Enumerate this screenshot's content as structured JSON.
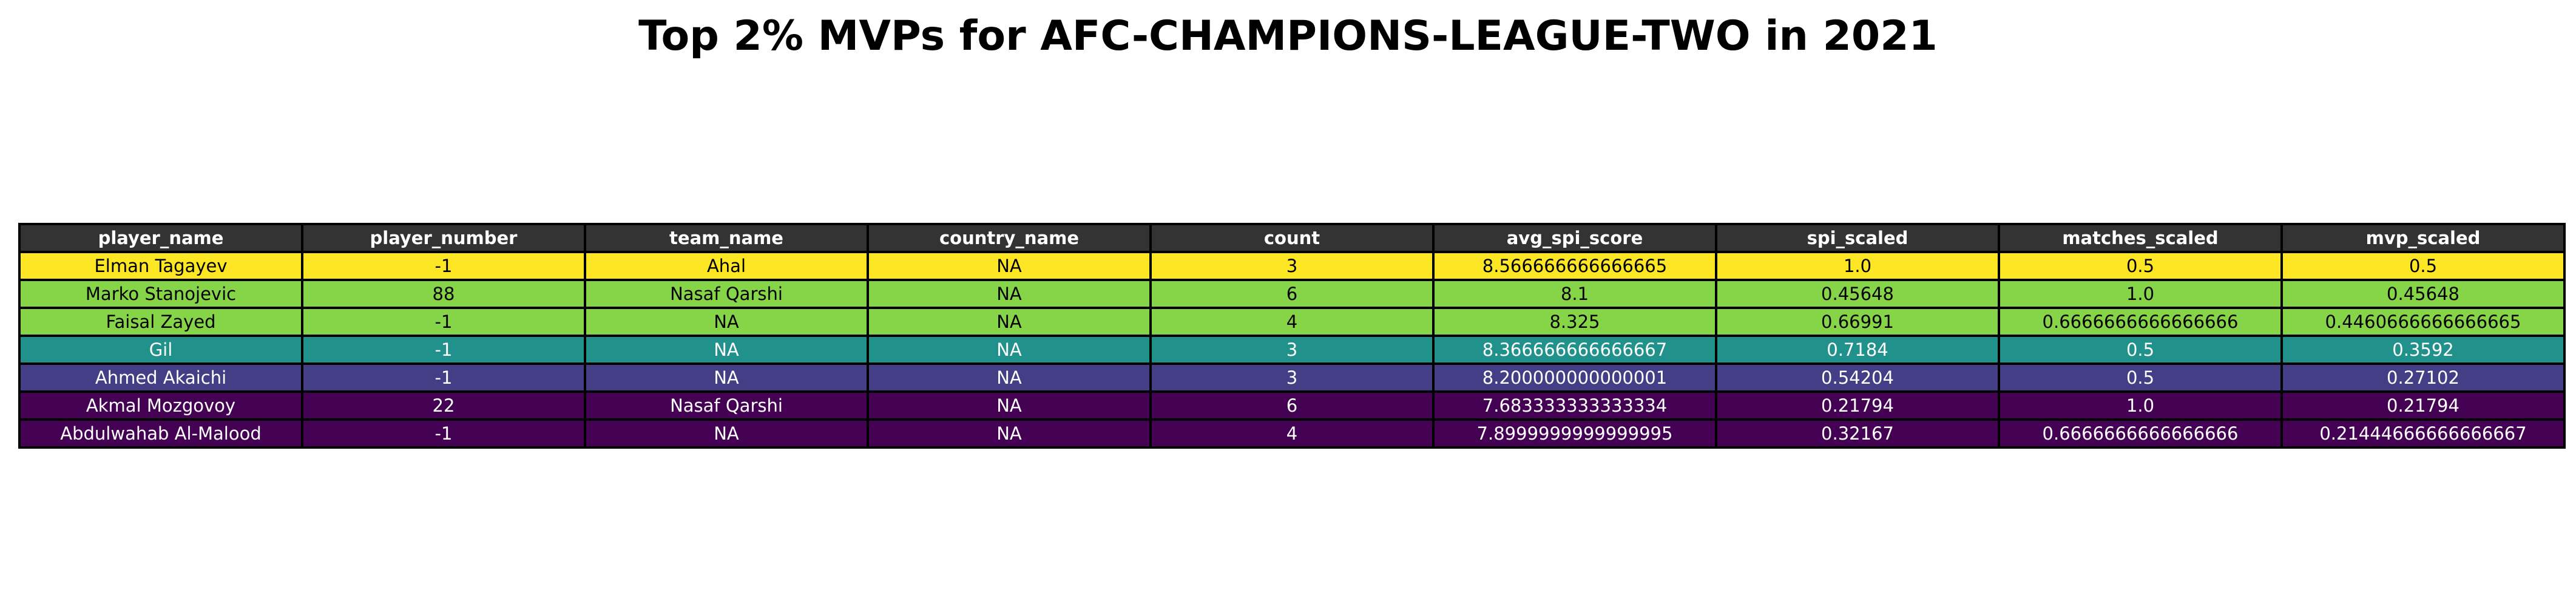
{
  "chart_data": {
    "type": "table",
    "title": "Top 2% MVPs for AFC-CHAMPIONS-LEAGUE-TWO in 2021",
    "header_color": "#333333",
    "columns": [
      "player_name",
      "player_number",
      "team_name",
      "country_name",
      "count",
      "avg_spi_score",
      "spi_scaled",
      "matches_scaled",
      "mvp_scaled"
    ],
    "rows": [
      {
        "bg": "#fde725",
        "fg": "#000000",
        "cells": [
          "Elman Tagayev",
          "-1",
          "Ahal",
          "NA",
          "3",
          "8.566666666666665",
          "1.0",
          "0.5",
          "0.5"
        ]
      },
      {
        "bg": "#86d549",
        "fg": "#000000",
        "cells": [
          "Marko Stanojevic",
          "88",
          "Nasaf Qarshi",
          "NA",
          "6",
          "8.1",
          "0.45648",
          "1.0",
          "0.45648"
        ]
      },
      {
        "bg": "#86d549",
        "fg": "#000000",
        "cells": [
          "Faisal Zayed",
          "-1",
          "NA",
          "NA",
          "4",
          "8.325",
          "0.66991",
          "0.6666666666666666",
          "0.4460666666666665"
        ]
      },
      {
        "bg": "#21918c",
        "fg": "#ffffff",
        "cells": [
          "Gil",
          "-1",
          "NA",
          "NA",
          "3",
          "8.366666666666667",
          "0.7184",
          "0.5",
          "0.3592"
        ]
      },
      {
        "bg": "#433e85",
        "fg": "#ffffff",
        "cells": [
          "Ahmed Akaichi",
          "-1",
          "NA",
          "NA",
          "3",
          "8.200000000000001",
          "0.54204",
          "0.5",
          "0.27102"
        ]
      },
      {
        "bg": "#440154",
        "fg": "#ffffff",
        "cells": [
          "Akmal Mozgovoy",
          "22",
          "Nasaf Qarshi",
          "NA",
          "6",
          "7.683333333333334",
          "0.21794",
          "1.0",
          "0.21794"
        ]
      },
      {
        "bg": "#440154",
        "fg": "#ffffff",
        "cells": [
          "Abdulwahab Al-Malood",
          "-1",
          "NA",
          "NA",
          "4",
          "7.8999999999999995",
          "0.32167",
          "0.6666666666666666",
          "0.21444666666666667"
        ]
      }
    ]
  }
}
